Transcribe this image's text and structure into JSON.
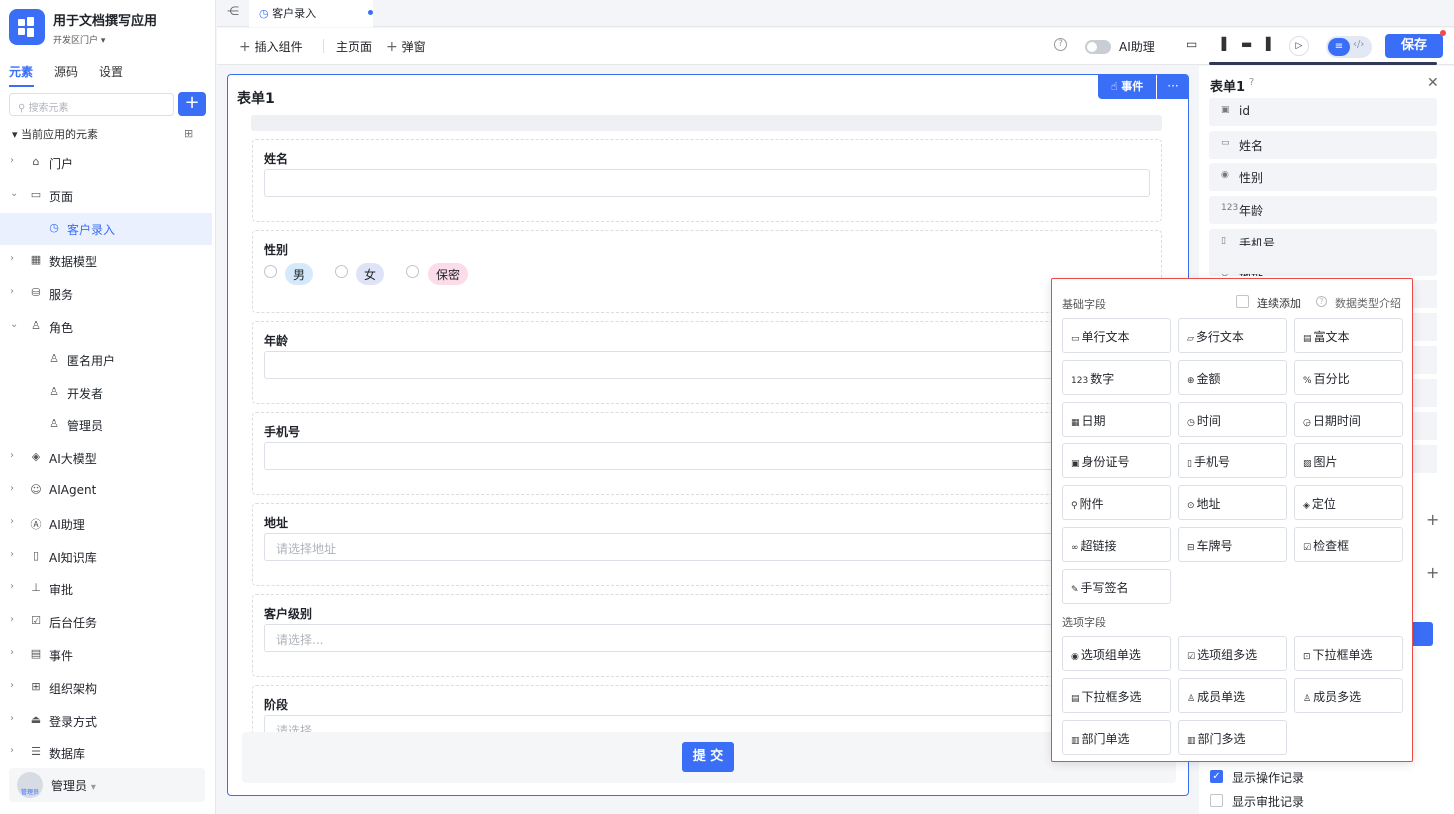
{
  "app": {
    "title": "用于文档撰写应用",
    "env": "开发区门户 ▾"
  },
  "sidebar": {
    "tabs": [
      "元素",
      "源码",
      "设置"
    ],
    "search_placeholder": "搜索元素",
    "add": "+",
    "current_label": "当前应用的元素",
    "items": [
      {
        "label": "门户",
        "icon": "home-icon",
        "glyph": "⌂",
        "chev": "›",
        "indent": 0
      },
      {
        "label": "页面",
        "icon": "pages-icon",
        "glyph": "▭",
        "chev": "⌄",
        "indent": 0
      },
      {
        "label": "客户录入",
        "icon": "page-icon",
        "glyph": "◷",
        "chev": "",
        "indent": 1,
        "selected": true
      },
      {
        "label": "数据模型",
        "icon": "table-icon",
        "glyph": "▦",
        "chev": "›",
        "indent": 0
      },
      {
        "label": "服务",
        "icon": "service-icon",
        "glyph": "⛁",
        "chev": "›",
        "indent": 0
      },
      {
        "label": "角色",
        "icon": "role-icon",
        "glyph": "♙",
        "chev": "⌄",
        "indent": 0
      },
      {
        "label": "匿名用户",
        "icon": "user-icon",
        "glyph": "♙",
        "chev": "",
        "indent": 1
      },
      {
        "label": "开发者",
        "icon": "user-icon",
        "glyph": "♙",
        "chev": "",
        "indent": 1
      },
      {
        "label": "管理员",
        "icon": "user-icon",
        "glyph": "♙",
        "chev": "",
        "indent": 1
      },
      {
        "label": "AI大模型",
        "icon": "model-icon",
        "glyph": "◈",
        "chev": "›",
        "indent": 0
      },
      {
        "label": "AIAgent",
        "icon": "robot-icon",
        "glyph": "☺",
        "chev": "›",
        "indent": 0
      },
      {
        "label": "AI助理",
        "icon": "ai-icon",
        "glyph": "Ⓐ",
        "chev": "›",
        "indent": 0
      },
      {
        "label": "AI知识库",
        "icon": "book-icon",
        "glyph": "▯",
        "chev": "›",
        "indent": 0
      },
      {
        "label": "审批",
        "icon": "stamp-icon",
        "glyph": "⊥",
        "chev": "›",
        "indent": 0
      },
      {
        "label": "后台任务",
        "icon": "task-icon",
        "glyph": "☑",
        "chev": "›",
        "indent": 0
      },
      {
        "label": "事件",
        "icon": "event-icon",
        "glyph": "▤",
        "chev": "›",
        "indent": 0
      },
      {
        "label": "组织架构",
        "icon": "org-icon",
        "glyph": "⊞",
        "chev": "›",
        "indent": 0
      },
      {
        "label": "登录方式",
        "icon": "login-icon",
        "glyph": "⏏",
        "chev": "›",
        "indent": 0
      },
      {
        "label": "数据库",
        "icon": "database-icon",
        "glyph": "☰",
        "chev": "›",
        "indent": 0
      }
    ],
    "user": {
      "name": "管理员",
      "avatar_text": "管理员",
      "caret": "▾"
    }
  },
  "tabbar": {
    "collapse": "⋲",
    "tab_label": "客户录入",
    "tab_icon": "◷"
  },
  "toolbar": {
    "insert": "插入组件",
    "home": "主页面",
    "popup": "弹窗",
    "plus": "+",
    "help": "?",
    "ai_assistant": "AI助理",
    "save": "保存",
    "icons": [
      "▭",
      "▐",
      "▬",
      "▌",
      "▷"
    ],
    "seg_a": "≡",
    "seg_b": "‹/›"
  },
  "form": {
    "title": "表单1",
    "event_btn": "☝ 事件",
    "more": "···",
    "fields": [
      {
        "label": "姓名",
        "placeholder": ""
      },
      {
        "label": "性别",
        "radio": true
      },
      {
        "label": "年龄",
        "placeholder": ""
      },
      {
        "label": "手机号",
        "placeholder": ""
      },
      {
        "label": "地址",
        "placeholder": "请选择地址"
      },
      {
        "label": "客户级别",
        "placeholder": "请选择..."
      },
      {
        "label": "阶段",
        "placeholder": "请选择"
      }
    ],
    "gender_options": [
      {
        "label": "男",
        "bg": "#d6e9fb"
      },
      {
        "label": "女",
        "bg": "#dfe3f7"
      },
      {
        "label": "保密",
        "bg": "#fbdce8"
      }
    ],
    "submit": "提 交"
  },
  "right_panel": {
    "title": "表单1",
    "help": "?",
    "close": "✕",
    "fields": [
      {
        "label": "id",
        "glyph": "▣"
      },
      {
        "label": "姓名",
        "glyph": "▭"
      },
      {
        "label": "性别",
        "glyph": "◉"
      },
      {
        "label": "年龄",
        "glyph": "123"
      },
      {
        "label": "手机号",
        "glyph": "▯"
      },
      {
        "label": "地址",
        "glyph": "⊙"
      }
    ],
    "show_logs": "显示操作记录",
    "show_approval": "显示审批记录"
  },
  "popup": {
    "basic_title": "基础字段",
    "continuous_add": "连续添加",
    "help_icon": "?",
    "data_type_intro": "数据类型介绍",
    "basic": [
      {
        "label": "单行文本",
        "glyph": "▭"
      },
      {
        "label": "多行文本",
        "glyph": "▱"
      },
      {
        "label": "富文本",
        "glyph": "▤"
      },
      {
        "label": "数字",
        "glyph": "123"
      },
      {
        "label": "金额",
        "glyph": "⊕"
      },
      {
        "label": "百分比",
        "glyph": "%"
      },
      {
        "label": "日期",
        "glyph": "▦"
      },
      {
        "label": "时间",
        "glyph": "◷"
      },
      {
        "label": "日期时间",
        "glyph": "◶"
      },
      {
        "label": "身份证号",
        "glyph": "▣"
      },
      {
        "label": "手机号",
        "glyph": "▯"
      },
      {
        "label": "图片",
        "glyph": "▨"
      },
      {
        "label": "附件",
        "glyph": "⚲"
      },
      {
        "label": "地址",
        "glyph": "⊙"
      },
      {
        "label": "定位",
        "glyph": "◈"
      },
      {
        "label": "超链接",
        "glyph": "∞"
      },
      {
        "label": "车牌号",
        "glyph": "⊟"
      },
      {
        "label": "检查框",
        "glyph": "☑"
      },
      {
        "label": "手写签名",
        "glyph": "✎"
      }
    ],
    "option_title": "选项字段",
    "options": [
      {
        "label": "选项组单选",
        "glyph": "◉"
      },
      {
        "label": "选项组多选",
        "glyph": "☑"
      },
      {
        "label": "下拉框单选",
        "glyph": "⊡"
      },
      {
        "label": "下拉框多选",
        "glyph": "▤"
      },
      {
        "label": "成员单选",
        "glyph": "♙"
      },
      {
        "label": "成员多选",
        "glyph": "♙"
      },
      {
        "label": "部门单选",
        "glyph": "▥"
      },
      {
        "label": "部门多选",
        "glyph": "▥"
      }
    ]
  },
  "colors": {
    "accent": "#3a6ef6",
    "popup_border": "#ea4c45"
  }
}
